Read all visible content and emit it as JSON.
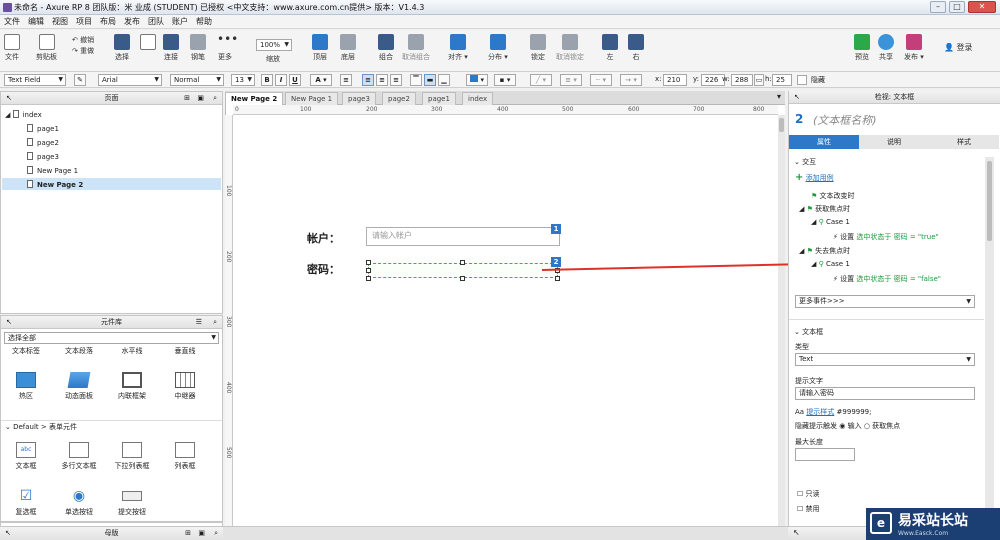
{
  "window": {
    "title": "未命名 - Axure RP 8 团队版：米 业成 (STUDENT) 已授权     <中文支持：www.axure.com.cn提供> 版本：V1.4.3"
  },
  "menu": [
    "文件",
    "编辑",
    "视图",
    "项目",
    "布局",
    "发布",
    "团队",
    "账户",
    "帮助"
  ],
  "toolbar": {
    "file": "文件",
    "clipboard": "剪贴板",
    "undo": "撤销",
    "redo": "重做",
    "select": "选择",
    "connect": "连接",
    "pen": "钢笔",
    "more": "更多",
    "zoom_value": "100%",
    "zoom": "缩放",
    "top": "顶层",
    "bottom": "底层",
    "group": "组合",
    "ungroup": "取消组合",
    "align": "对齐",
    "distribute": "分布",
    "lock": "锁定",
    "unlock": "取消锁定",
    "left": "左",
    "right": "右",
    "preview": "预览",
    "share": "共享",
    "publish": "发布",
    "login": "登录"
  },
  "format": {
    "widget_type": "Text Field",
    "font": "Arial",
    "weight": "Normal",
    "size": "13",
    "x_label": "x:",
    "x": "210",
    "y_label": "y:",
    "y": "226",
    "w_label": "w:",
    "w": "288",
    "h_label": "h:",
    "h": "25",
    "hidden": "隐藏"
  },
  "pages_panel": {
    "title": "页面",
    "items": [
      "index",
      "page1",
      "page2",
      "page3",
      "New Page 1",
      "New Page 2"
    ],
    "selected": "New Page 2"
  },
  "library": {
    "title": "元件库",
    "filter": "选择全部",
    "top_labels": [
      "文本标签",
      "文本段落",
      "水平线",
      "垂直线"
    ],
    "row1": [
      "热区",
      "动态面板",
      "内联框架",
      "中继器"
    ],
    "section": "Default > 表单元件",
    "row2": [
      "文本框",
      "多行文本框",
      "下拉列表框",
      "列表框"
    ],
    "row3": [
      "复选框",
      "单选按钮",
      "提交按钮"
    ]
  },
  "masters_panel": {
    "title": "母版"
  },
  "tabs": [
    "New Page 2",
    "New Page 1",
    "page3",
    "page2",
    "page1",
    "index"
  ],
  "ruler": {
    "h": [
      "0",
      "100",
      "200",
      "300",
      "400",
      "500",
      "600",
      "700",
      "800"
    ],
    "v": [
      "100",
      "200",
      "300",
      "400",
      "500"
    ]
  },
  "canvas": {
    "account_label": "帐户：",
    "account_placeholder": "请输入帐户",
    "badge1": "1",
    "password_label": "密码：",
    "badge2": "2"
  },
  "inspector": {
    "header": "检视: 文本框",
    "number": "2",
    "name_placeholder": "(文本框名称)",
    "tabs": [
      "属性",
      "说明",
      "样式"
    ],
    "interaction": "交互",
    "add_case": "添加用例",
    "ev_text_change": "文本改变时",
    "ev_focus": "获取焦点时",
    "case1": "Case 1",
    "action_true_prefix": "设置",
    "action_true": "选中状态于 密码 = \"true\"",
    "ev_blur": "失去焦点时",
    "case2": "Case 1",
    "action_false_prefix": "设置",
    "action_false": "选中状态于 密码 = \"false\"",
    "more_events": "更多事件>>>",
    "textbox_section": "文本框",
    "type_label": "类型",
    "type_value": "Text",
    "hint_label": "提示文字",
    "hint_value": "请输入密码",
    "hint_style_link": "提示样式",
    "hint_style_value": "#999999;",
    "hide_trigger": "隐藏提示触发",
    "radio_input": "输入",
    "radio_focus": "获取焦点",
    "maxlen_label": "最大长度",
    "readonly": "只读",
    "disabled": "禁用"
  },
  "watermark": {
    "site": "易采站长站",
    "url": "Www.Easck.Com"
  }
}
